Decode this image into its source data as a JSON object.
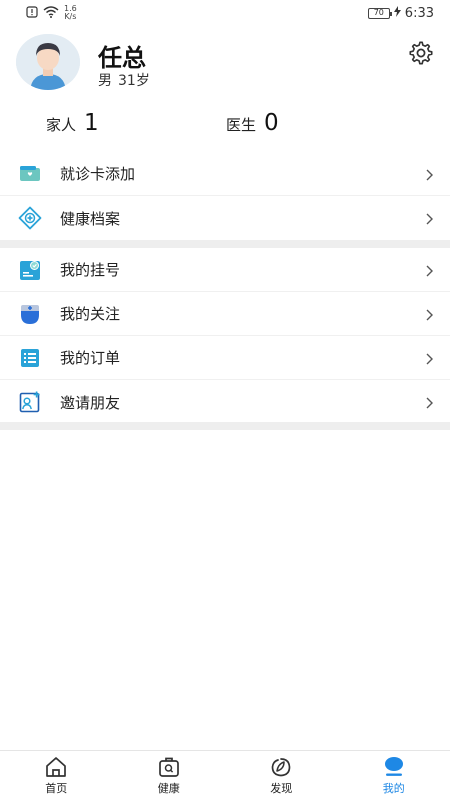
{
  "status_bar": {
    "net_speed_value": "1.6",
    "net_speed_unit": "K/s",
    "battery": "70",
    "time": "6:33"
  },
  "profile": {
    "name": "任总",
    "gender": "男",
    "age": "31岁"
  },
  "stats": {
    "family_label": "家人",
    "family_count": "1",
    "doctor_label": "医生",
    "doctor_count": "0"
  },
  "menu": {
    "group1": [
      {
        "label": "就诊卡添加",
        "icon": "card-icon"
      },
      {
        "label": "健康档案",
        "icon": "health-record-icon"
      }
    ],
    "group2": [
      {
        "label": "我的挂号",
        "icon": "registration-icon"
      },
      {
        "label": "我的关注",
        "icon": "doctor-follow-icon"
      },
      {
        "label": "我的订单",
        "icon": "order-list-icon"
      },
      {
        "label": "邀请朋友",
        "icon": "invite-friend-icon"
      }
    ]
  },
  "bottom_nav": [
    {
      "label": "首页",
      "icon": "home-icon",
      "active": false
    },
    {
      "label": "健康",
      "icon": "health-bag-icon",
      "active": false
    },
    {
      "label": "发现",
      "icon": "discover-icon",
      "active": false
    },
    {
      "label": "我的",
      "icon": "profile-icon",
      "active": true
    }
  ],
  "colors": {
    "accent": "#1e88e5",
    "icon_blue": "#2aa3d8",
    "divider": "#eeeeee"
  }
}
